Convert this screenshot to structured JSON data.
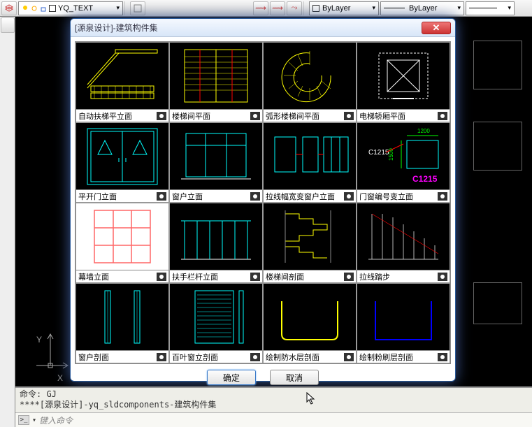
{
  "toolbar": {
    "layer_name": "YQ_TEXT",
    "bylayer1": "ByLayer",
    "bylayer2": "ByLayer"
  },
  "dialog": {
    "title": "[源泉设计]-建筑构件集",
    "ok": "确定",
    "cancel": "取消",
    "items": [
      {
        "label": "自动扶梯平立面"
      },
      {
        "label": "楼梯间平面"
      },
      {
        "label": "弧形楼梯间平面"
      },
      {
        "label": "电梯轿厢平面"
      },
      {
        "label": "平开门立面"
      },
      {
        "label": "窗户立面"
      },
      {
        "label": "拉线幅宽变窗户立面"
      },
      {
        "label": "门窗编号变立面"
      },
      {
        "label": "幕墙立面"
      },
      {
        "label": "扶手栏杆立面"
      },
      {
        "label": "楼梯间剖面"
      },
      {
        "label": "拉线踏步"
      },
      {
        "label": "窗户剖面"
      },
      {
        "label": "百叶窗立剖面"
      },
      {
        "label": "绘制防水层剖面"
      },
      {
        "label": "绘制粉刷层剖面"
      }
    ],
    "cell8": {
      "dim1": "1200",
      "dim2": "1500",
      "code1": "C1215",
      "code2": "C1215"
    }
  },
  "command": {
    "line1": "命令: GJ",
    "line2": "****[源泉设计]-yq_sldcomponents-建筑构件集",
    "prompt": "键入命令"
  },
  "ucs": {
    "x": "X",
    "y": "Y"
  }
}
